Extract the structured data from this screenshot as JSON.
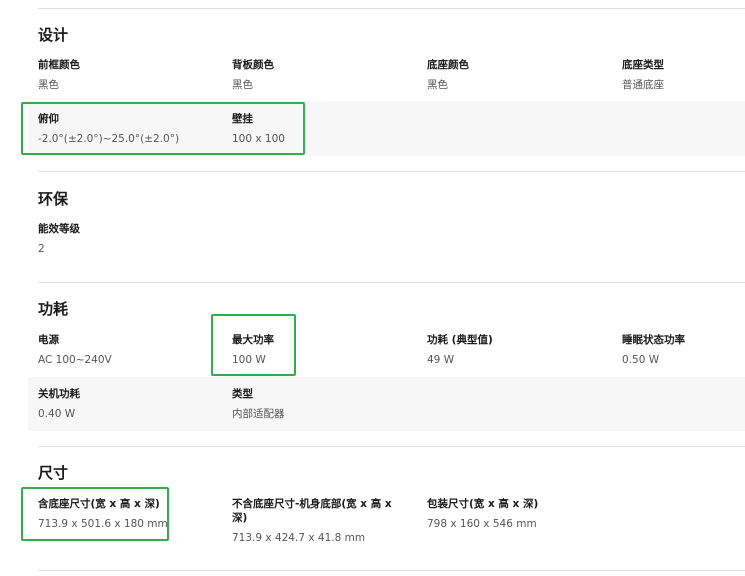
{
  "accent_highlight": "#2fae49",
  "sections": {
    "design": {
      "title": "设计",
      "specs": [
        {
          "label": "前框颜色",
          "value": "黑色"
        },
        {
          "label": "背板颜色",
          "value": "黑色"
        },
        {
          "label": "底座颜色",
          "value": "黑色"
        },
        {
          "label": "底座类型",
          "value": "普通底座"
        },
        {
          "label": "俯仰",
          "value": "-2.0°(±2.0°)~25.0°(±2.0°)"
        },
        {
          "label": "壁挂",
          "value": "100 x 100"
        }
      ]
    },
    "eco": {
      "title": "环保",
      "specs": [
        {
          "label": "能效等级",
          "value": "2"
        }
      ]
    },
    "power": {
      "title": "功耗",
      "specs": [
        {
          "label": "电源",
          "value": "AC 100~240V"
        },
        {
          "label": "最大功率",
          "value": "100 W"
        },
        {
          "label": "功耗 (典型值)",
          "value": "49 W"
        },
        {
          "label": "睡眠状态功率",
          "value": "0.50 W"
        },
        {
          "label": "关机功耗",
          "value": "0.40 W"
        },
        {
          "label": "类型",
          "value": "内部适配器"
        }
      ]
    },
    "size": {
      "title": "尺寸",
      "specs": [
        {
          "label": "含底座尺寸(宽 x 高 x 深)",
          "value": "713.9 x 501.6 x 180 mm"
        },
        {
          "label": "不含底座尺寸-机身底部(宽 x 高 x 深)",
          "value": "713.9 x 424.7 x 41.8 mm"
        },
        {
          "label": "包装尺寸(宽 x 高 x 深)",
          "value": "798 x 160 x 546 mm"
        }
      ]
    }
  }
}
